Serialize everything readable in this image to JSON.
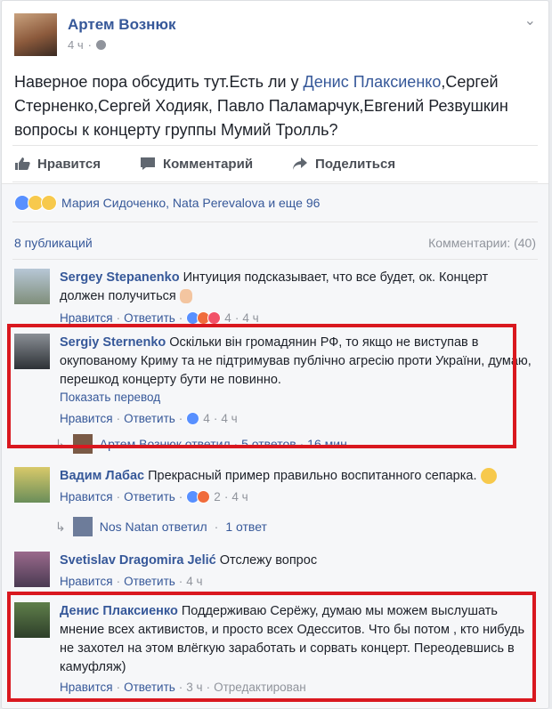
{
  "post": {
    "author": "Артем Вознюк",
    "time": "4 ч",
    "text_before": "Наверное пора обсудить тут.Есть ли у ",
    "mention": "Денис Плаксиенко",
    "text_after": ",Сергей Стерненко,Сергей Ходияк, Павло Паламарчук,Евгений Резвушкин вопросы к концерту группы Мумий Тролль?"
  },
  "actions": {
    "like": "Нравится",
    "comment": "Комментарий",
    "share": "Поделиться"
  },
  "reactions": {
    "names": "Мария Сидоченко, Nata Perevalova и еще 96"
  },
  "publications": "8 публикаций",
  "comments_count": "Комментарии: (40)",
  "comments": [
    {
      "name": "Sergey Stepanenko",
      "text": "Интуиция подсказывает, что все будет, ок. Концерт должен получиться",
      "like": "Нравится",
      "reply": "Ответить",
      "reactions": "4",
      "time": "4 ч"
    },
    {
      "name": "Sergiy Sternenko",
      "text": "Оскільки він громадянин РФ, то якщо не виступав в окупованому Криму та не підтримував публічно агресію проти України, думаю, перешкод концерту бути не повинно.",
      "translate": "Показать перевод",
      "like": "Нравится",
      "reply": "Ответить",
      "reactions": "4",
      "time": "4 ч",
      "replies_line": "Артем Вознюк ответил · 5 ответов · 16 мин"
    },
    {
      "name": "Вадим Лабас",
      "text": "Прекрасный пример правильно воспитанного сепарка.",
      "like": "Нравится",
      "reply": "Ответить",
      "reactions": "2",
      "time": "4 ч",
      "replies_author": "Nos Natan ответил",
      "replies_count": "1 ответ"
    },
    {
      "name": "Svetislav Dragomira Jelić",
      "text": "Отслежу вопрос",
      "like": "Нравится",
      "reply": "Ответить",
      "time": "4 ч"
    },
    {
      "name": "Денис Плаксиенко",
      "text": "Поддерживаю Серёжу, думаю мы можем выслушать мнение всех активистов, и просто всех Одесситов. Что бы потом , кто нибудь не захотел на этом влёгкую заработать и сорвать концерт. Переодевшись в камуфляж)",
      "like": "Нравится",
      "reply": "Ответить",
      "time": "3 ч",
      "edited": "Отредактирован"
    }
  ],
  "colors": {
    "link": "#365899",
    "highlight": "#d9181f",
    "muted": "#90949c"
  }
}
